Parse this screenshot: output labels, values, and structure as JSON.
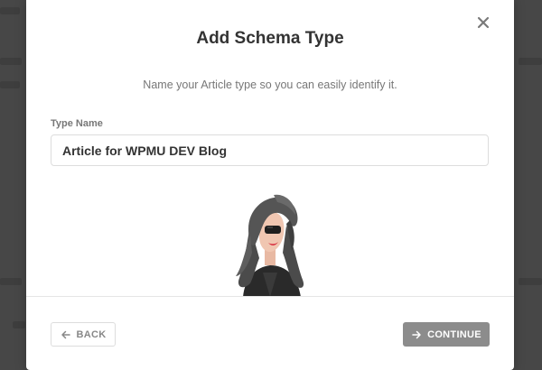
{
  "modal": {
    "title": "Add Schema Type",
    "subtitle": "Name your Article type so you can easily identify it.",
    "close_icon": "close-icon",
    "field": {
      "label": "Type Name",
      "value": "Article for WPMU DEV Blog"
    },
    "buttons": {
      "back_label": "BACK",
      "back_icon": "arrow-left-icon",
      "continue_label": "CONTINUE",
      "continue_icon": "arrow-right-icon"
    },
    "illustration": "mascot-character-illustration"
  },
  "colors": {
    "modal_bg": "#ffffff",
    "title": "#333333",
    "muted_text": "#777777",
    "continue_bg": "#8c8c8c",
    "overlay": "#4a4a4a"
  }
}
